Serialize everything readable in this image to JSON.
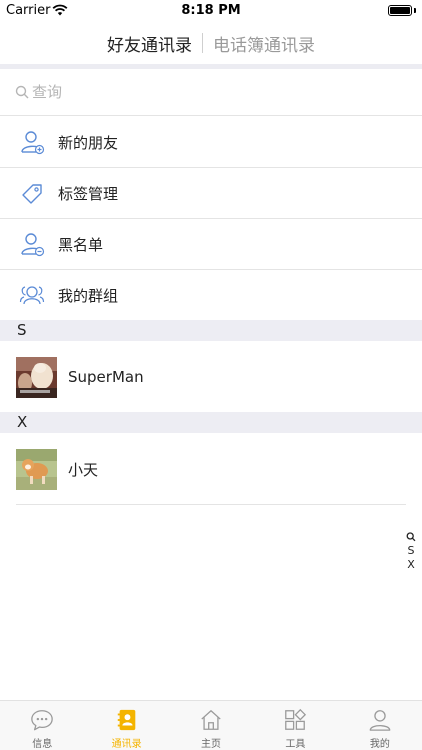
{
  "status_bar": {
    "carrier": "Carrier",
    "time": "8:18 PM"
  },
  "nav": {
    "tab_friends": "好友通讯录",
    "tab_phonebook": "电话簿通讯录"
  },
  "search": {
    "placeholder": "查询"
  },
  "menu": [
    {
      "label": "新的朋友",
      "icon": "add-user-icon"
    },
    {
      "label": "标签管理",
      "icon": "tag-icon"
    },
    {
      "label": "黑名单",
      "icon": "blocked-user-icon"
    },
    {
      "label": "我的群组",
      "icon": "group-icon"
    }
  ],
  "sections": [
    {
      "letter": "S",
      "contacts": [
        {
          "name": "SuperMan"
        }
      ]
    },
    {
      "letter": "X",
      "contacts": [
        {
          "name": "小天"
        }
      ]
    }
  ],
  "index_bar": [
    "S",
    "X"
  ],
  "tabbar": {
    "items": [
      {
        "label": "信息",
        "icon": "chat-icon"
      },
      {
        "label": "通讯录",
        "icon": "contacts-icon",
        "active": true
      },
      {
        "label": "主页",
        "icon": "home-icon"
      },
      {
        "label": "工具",
        "icon": "tools-icon"
      },
      {
        "label": "我的",
        "icon": "profile-icon"
      }
    ],
    "active_color": "#f4b400"
  },
  "colors": {
    "icon_blue": "#5b8bd6",
    "section_bg": "#ededf3"
  }
}
